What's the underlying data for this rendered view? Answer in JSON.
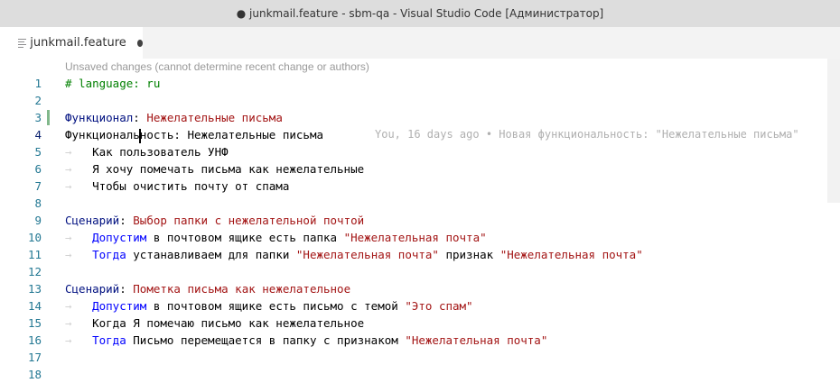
{
  "window": {
    "title": "● junkmail.feature - sbm-qa - Visual Studio Code [Администратор]"
  },
  "tab": {
    "label": "junkmail.feature",
    "icon": "file-lines-icon",
    "dirty_indicator": "●"
  },
  "editor": {
    "code_lens": "Unsaved changes (cannot determine recent change or authors)",
    "blame": "You, 16 days ago • Новая функциональность: \"Нежелательные письма\"",
    "lines": [
      {
        "num": "1",
        "parts": [
          {
            "t": "# language: ru",
            "c": "comment"
          }
        ]
      },
      {
        "num": "2",
        "parts": []
      },
      {
        "num": "3",
        "parts": [
          {
            "t": "Функционал",
            "c": "blue"
          },
          {
            "t": ": ",
            "c": "plain"
          },
          {
            "t": "Нежелательные письма",
            "c": "title"
          }
        ]
      },
      {
        "num": "4",
        "parts": [
          {
            "t": "Функциональ",
            "c": "plain"
          },
          {
            "t": "ность: Нежелательные письма",
            "c": "plain"
          }
        ]
      },
      {
        "num": "5",
        "parts": [
          {
            "t": "→   ",
            "c": "ws"
          },
          {
            "t": "Как пользователь УНФ",
            "c": "plain"
          }
        ]
      },
      {
        "num": "6",
        "parts": [
          {
            "t": "→   ",
            "c": "ws"
          },
          {
            "t": "Я хочу помечать письма как нежелательные",
            "c": "plain"
          }
        ]
      },
      {
        "num": "7",
        "parts": [
          {
            "t": "→   ",
            "c": "ws"
          },
          {
            "t": "Чтобы очистить почту от спама",
            "c": "plain"
          }
        ]
      },
      {
        "num": "8",
        "parts": []
      },
      {
        "num": "9",
        "parts": [
          {
            "t": "Сценарий",
            "c": "blue"
          },
          {
            "t": ": ",
            "c": "plain"
          },
          {
            "t": "Выбор папки с нежелательной почтой",
            "c": "title"
          }
        ]
      },
      {
        "num": "10",
        "parts": [
          {
            "t": "→   ",
            "c": "ws"
          },
          {
            "t": "Допустим",
            "c": "keyword"
          },
          {
            "t": " в почтовом ящике есть папка ",
            "c": "plain"
          },
          {
            "t": "\"Нежелательная почта\"",
            "c": "string"
          }
        ]
      },
      {
        "num": "11",
        "parts": [
          {
            "t": "→   ",
            "c": "ws"
          },
          {
            "t": "Тогда",
            "c": "keyword"
          },
          {
            "t": " устанавливаем для папки ",
            "c": "plain"
          },
          {
            "t": "\"Нежелательная почта\"",
            "c": "string"
          },
          {
            "t": " признак ",
            "c": "plain"
          },
          {
            "t": "\"Нежелательная почта\"",
            "c": "string"
          }
        ]
      },
      {
        "num": "12",
        "parts": []
      },
      {
        "num": "13",
        "parts": [
          {
            "t": "Сценарий",
            "c": "blue"
          },
          {
            "t": ": ",
            "c": "plain"
          },
          {
            "t": "Пометка письма как нежелательное",
            "c": "title"
          }
        ]
      },
      {
        "num": "14",
        "parts": [
          {
            "t": "→   ",
            "c": "ws"
          },
          {
            "t": "Допустим",
            "c": "keyword"
          },
          {
            "t": " в почтовом ящике есть письмо с темой ",
            "c": "plain"
          },
          {
            "t": "\"Это спам\"",
            "c": "string"
          }
        ]
      },
      {
        "num": "15",
        "parts": [
          {
            "t": "→   ",
            "c": "ws"
          },
          {
            "t": "Когда Я помечаю письмо как нежелательное",
            "c": "plain"
          }
        ]
      },
      {
        "num": "16",
        "parts": [
          {
            "t": "→   ",
            "c": "ws"
          },
          {
            "t": "Тогда",
            "c": "keyword"
          },
          {
            "t": " Письмо перемещается в папку с признаком ",
            "c": "plain"
          },
          {
            "t": "\"Нежелательная почта\"",
            "c": "string"
          }
        ]
      },
      {
        "num": "17",
        "parts": []
      },
      {
        "num": "18",
        "parts": []
      }
    ]
  }
}
